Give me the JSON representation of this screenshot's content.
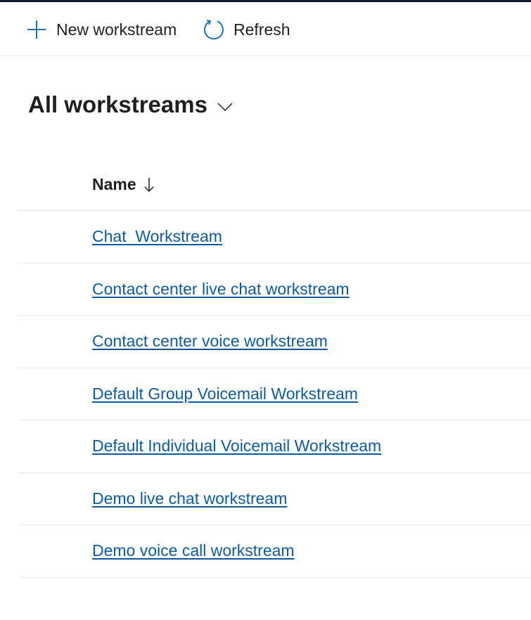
{
  "toolbar": {
    "new_label": "New workstream",
    "refresh_label": "Refresh",
    "new_icon": "plus-icon",
    "refresh_icon": "refresh-icon"
  },
  "view": {
    "title": "All workstreams",
    "selector_icon": "chevron-down-icon"
  },
  "grid": {
    "columns": [
      {
        "label": "Name",
        "sort": "descending",
        "sort_icon": "arrow-down-icon"
      }
    ],
    "rows": [
      {
        "name": "Chat_Workstream"
      },
      {
        "name": "Contact center live chat workstream"
      },
      {
        "name": "Contact center voice workstream"
      },
      {
        "name": "Default Group Voicemail Workstream"
      },
      {
        "name": "Default Individual Voicemail Workstream"
      },
      {
        "name": "Demo live chat workstream"
      },
      {
        "name": "Demo voice call workstream"
      }
    ]
  },
  "colors": {
    "link": "#0f5a9c",
    "icon_accent": "#1d72b8",
    "text": "#201f1e",
    "top_bar": "#0b1b2e"
  }
}
